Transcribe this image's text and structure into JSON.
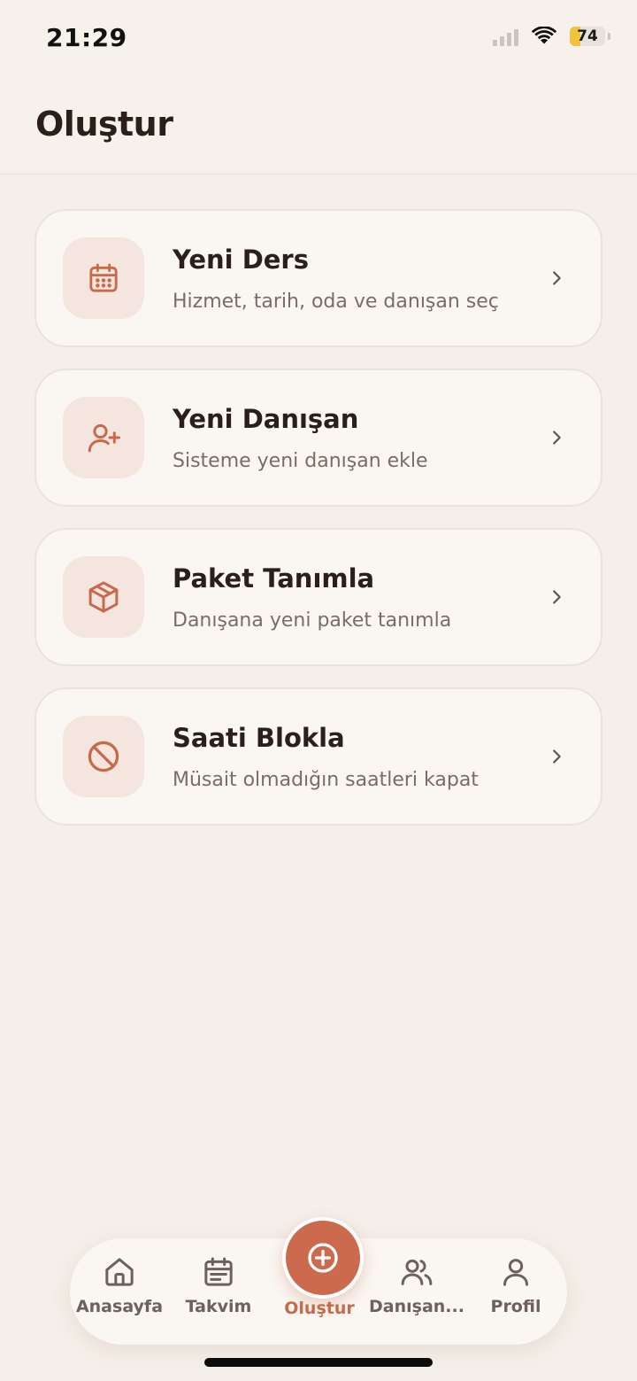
{
  "status_bar": {
    "time": "21:29",
    "battery_level": "74",
    "icons": [
      "signal-icon",
      "wifi-icon",
      "battery-charging-icon"
    ]
  },
  "header": {
    "title": "Oluştur"
  },
  "actions": [
    {
      "title": "Yeni Ders",
      "subtitle": "Hizmet, tarih, oda ve danışan seç",
      "icon": "calendar-icon"
    },
    {
      "title": "Yeni Danışan",
      "subtitle": "Sisteme yeni danışan ekle",
      "icon": "user-plus-icon"
    },
    {
      "title": "Paket Tanımla",
      "subtitle": "Danışana yeni paket tanımla",
      "icon": "package-icon"
    },
    {
      "title": "Saati Blokla",
      "subtitle": "Müsait olmadığın saatleri kapat",
      "icon": "block-icon"
    }
  ],
  "tabbar": {
    "tabs": [
      {
        "label": "Anasayfa",
        "icon": "home-icon"
      },
      {
        "label": "Takvim",
        "icon": "calendar-icon"
      },
      {
        "label": "Oluştur",
        "icon": "plus-circle-icon",
        "active": true
      },
      {
        "label": "Danışan...",
        "icon": "users-icon"
      },
      {
        "label": "Profil",
        "icon": "user-icon"
      }
    ]
  },
  "colors": {
    "background": "#f5efe9",
    "card": "#faf7f2",
    "accent": "#cb6a4c",
    "icon_tile": "#f4e6df",
    "text_primary": "#2a2019",
    "text_secondary": "#7a6d64"
  }
}
